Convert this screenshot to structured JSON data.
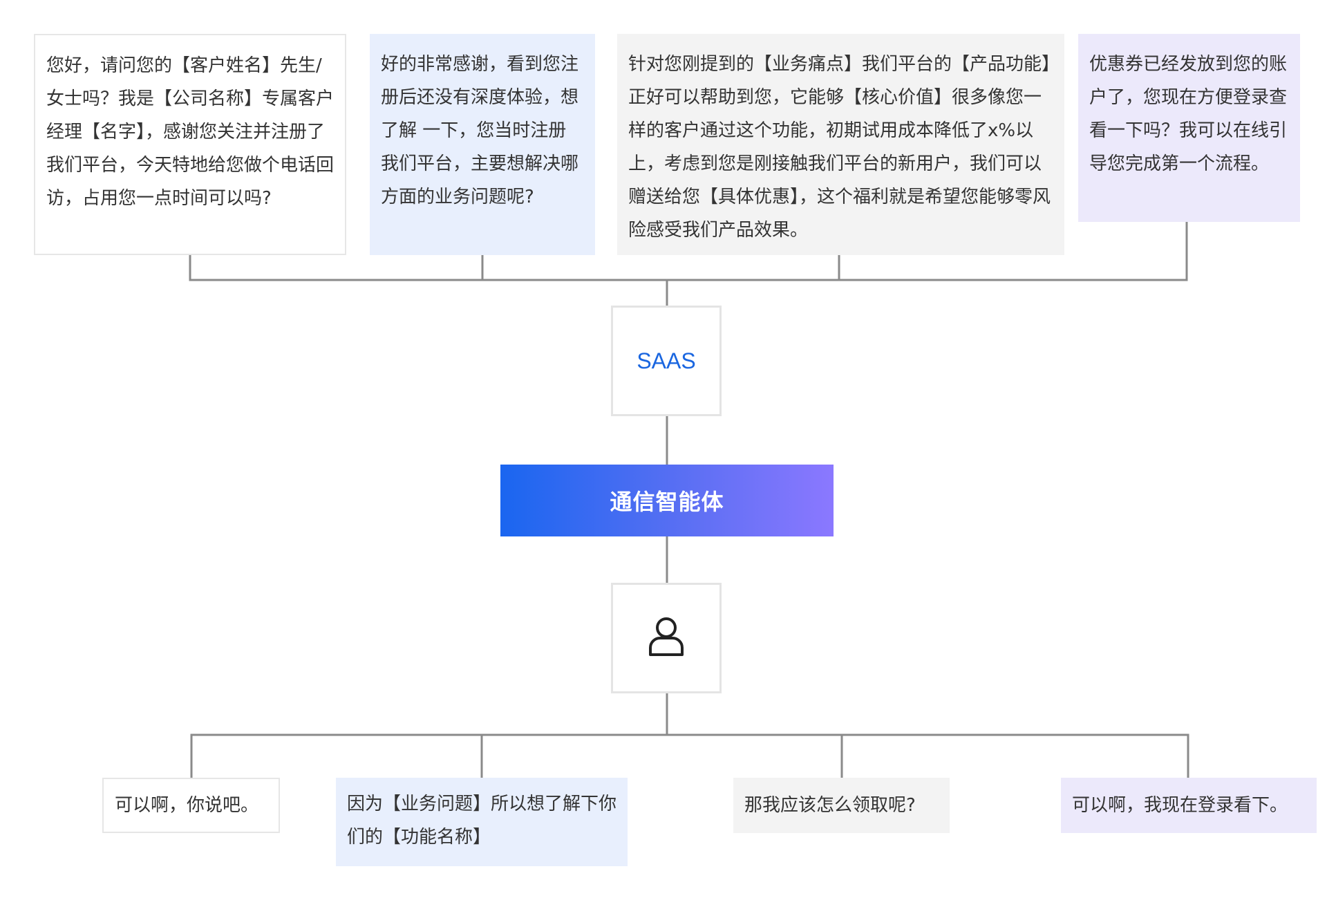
{
  "top_bubbles": [
    {
      "text": "您好，请问您的【客户姓名】先生/女士吗？我是【公司名称】专属客户经理【名字】，感谢您关注并注册了我们平台，今天特地给您做个电话回访，占用您一点时间可以吗?",
      "style": "white"
    },
    {
      "text": "好的非常感谢，看到您注册后还没有深度体验，想了解 一下，您当时注册我们平台，主要想解决哪方面的业务问题呢?",
      "style": "blue"
    },
    {
      "text": "针对您刚提到的【业务痛点】我们平台的【产品功能】正好可以帮助到您，它能够【核心价值】很多像您一样的客户通过这个功能，初期试用成本降低了x%以上，考虑到您是刚接触我们平台的新用户，我们可以赠送给您【具体优惠】，这个福利就是希望您能够零风险感受我们产品效果。",
      "style": "grey"
    },
    {
      "text": "优惠券已经发放到您的账户了，您现在方便登录查看一下吗？我可以在线引导您完成第一个流程。",
      "style": "purple"
    }
  ],
  "saas_node": {
    "label": "SAAS"
  },
  "agent_node": {
    "label": "通信智能体",
    "gradient_start": "#1a66f0",
    "gradient_end": "#8b78ff"
  },
  "user_node": {
    "icon": "user-icon"
  },
  "bottom_bubbles": [
    {
      "text": "可以啊，你说吧。",
      "style": "white"
    },
    {
      "text": "因为【业务问题】所以想了解下你们的【功能名称】",
      "style": "blue"
    },
    {
      "text": "那我应该怎么领取呢?",
      "style": "grey"
    },
    {
      "text": "可以啊，我现在登录看下。",
      "style": "purple"
    }
  ],
  "colors": {
    "connector": "#8a8a8a",
    "saas_text": "#1a66e0",
    "bubble_blue": "#e8effd",
    "bubble_grey": "#f3f3f3",
    "bubble_purple": "#ece9fb"
  }
}
